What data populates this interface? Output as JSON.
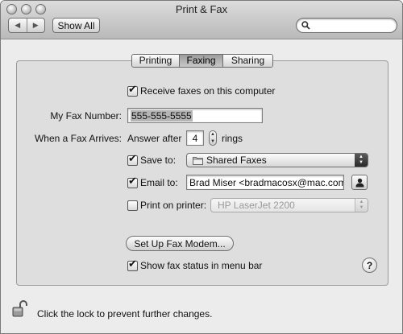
{
  "window": {
    "title": "Print & Fax"
  },
  "toolbar": {
    "back_icon": "left-arrow-icon",
    "forward_icon": "right-arrow-icon",
    "show_all_label": "Show All",
    "search_placeholder": ""
  },
  "tabs": [
    {
      "label": "Printing",
      "active": false
    },
    {
      "label": "Faxing",
      "active": true
    },
    {
      "label": "Sharing",
      "active": false
    }
  ],
  "fax": {
    "receive_label": "Receive faxes on this computer",
    "receive_checked": true,
    "number_label": "My Fax Number:",
    "number_value": "555-555-5555",
    "arrives_label": "When a Fax Arrives:",
    "answer_after_label": "Answer after",
    "rings_value": "4",
    "rings_label": "rings",
    "save_to_label": "Save to:",
    "save_to_checked": true,
    "save_to_value": "Shared Faxes",
    "email_to_label": "Email to:",
    "email_to_checked": true,
    "email_to_value": "Brad Miser <bradmacosx@mac.com",
    "print_label": "Print on printer:",
    "print_checked": false,
    "print_value": "HP LaserJet 2200",
    "setup_modem_label": "Set Up Fax Modem...",
    "status_label": "Show fax status in menu bar",
    "status_checked": true,
    "help_label": "?"
  },
  "footer": {
    "lock_text": "Click the lock to prevent further changes.",
    "lock_icon": "unlocked-padlock-icon"
  },
  "colors": {
    "panel_bg": "#dedede",
    "window_bg": "#ececec",
    "selected_tab": "#9c9c9c"
  }
}
